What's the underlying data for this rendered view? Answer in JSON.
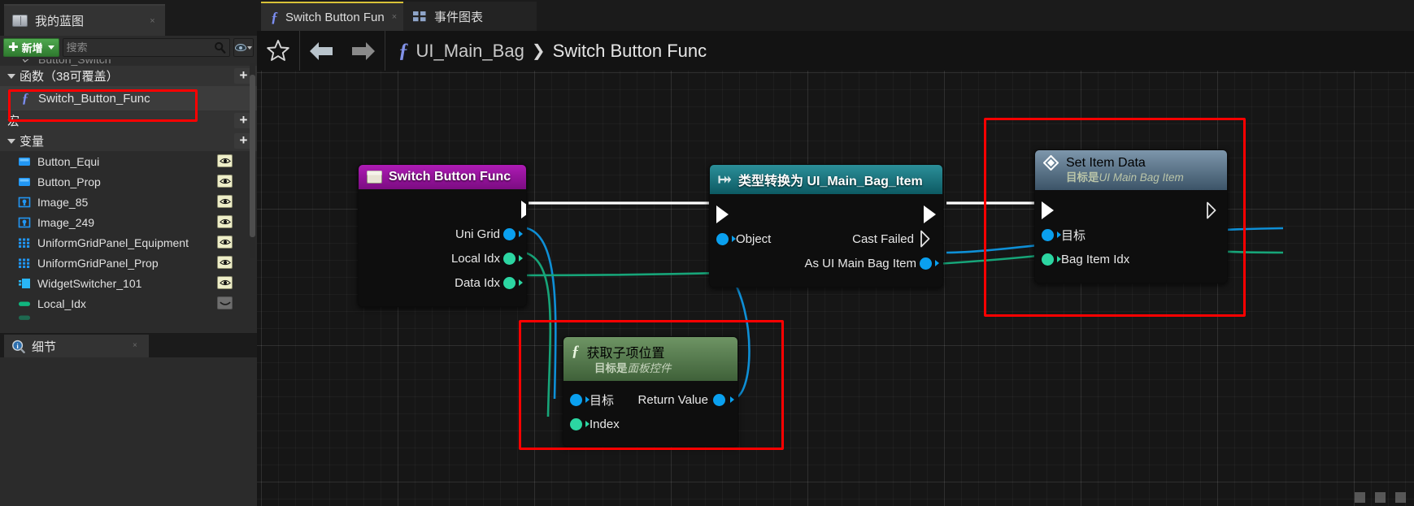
{
  "left_panel": {
    "tab": {
      "label": "我的蓝图",
      "icon": "blueprint-book-icon",
      "close": "×"
    },
    "toolbar": {
      "add_label": "新增",
      "add_icon": "plus-icon",
      "search_placeholder": "搜索",
      "search_value": "",
      "search_icon": "search-icon",
      "eye_icon": "eye-icon"
    },
    "clipped_row": {
      "label": "Button_Switch"
    },
    "sections": [
      {
        "label": "函数（38可覆盖）",
        "add": "+"
      },
      {
        "label": "宏",
        "add": "+"
      },
      {
        "label": "变量",
        "add": "+"
      }
    ],
    "function_item": {
      "label": "Switch_Button_Func",
      "icon": "function-icon"
    },
    "variables": [
      {
        "label": "Button_Equi",
        "icon": "button-widget-icon",
        "visible": true
      },
      {
        "label": "Button_Prop",
        "icon": "button-widget-icon",
        "visible": true
      },
      {
        "label": "Image_85",
        "icon": "image-widget-icon",
        "visible": true
      },
      {
        "label": "Image_249",
        "icon": "image-widget-icon",
        "visible": true
      },
      {
        "label": "UniformGridPanel_Equipment",
        "icon": "grid-panel-icon",
        "visible": true
      },
      {
        "label": "UniformGridPanel_Prop",
        "icon": "grid-panel-icon",
        "visible": true
      },
      {
        "label": "WidgetSwitcher_101",
        "icon": "widget-switcher-icon",
        "visible": true
      },
      {
        "label": "Local_Idx",
        "icon": "integer-variable-icon",
        "visible": false
      }
    ],
    "details": {
      "label": "细节",
      "icon": "details-info-icon",
      "close": "×"
    }
  },
  "graph": {
    "tabs": [
      {
        "label": "Switch Button Fun",
        "icon": "function-icon",
        "close": "×",
        "active": true
      },
      {
        "label": "事件图表",
        "icon": "event-graph-icon",
        "active": false
      }
    ],
    "toolbar": {
      "favorite_icon": "star-icon",
      "back_icon": "back-arrow-icon",
      "forward_icon": "forward-arrow-icon",
      "breadcrumb_icon": "function-icon",
      "breadcrumb": [
        "UI_Main_Bag",
        "Switch Button Func"
      ],
      "breadcrumb_separator": "❯"
    },
    "nodes": [
      {
        "id": "switch-button-func",
        "title": "Switch Button Func",
        "header_icon": "function-entry-icon",
        "header_color": "#a118a8",
        "outputs": [
          {
            "label": "",
            "type": "exec"
          },
          {
            "label": "Uni Grid",
            "type": "object"
          },
          {
            "label": "Local Idx",
            "type": "int"
          },
          {
            "label": "Data Idx",
            "type": "int"
          }
        ]
      },
      {
        "id": "cast-to-ui-main-bag-item",
        "title": "类型转换为 UI_Main_Bag_Item",
        "header_icon": "cast-icon",
        "header_color": "#1b7a85",
        "inputs": [
          {
            "label": "",
            "type": "exec"
          },
          {
            "label": "Object",
            "type": "object"
          }
        ],
        "outputs": [
          {
            "label": "",
            "type": "exec"
          },
          {
            "label": "Cast Failed",
            "type": "exec-hollow"
          },
          {
            "label": "As UI Main Bag Item",
            "type": "object"
          }
        ]
      },
      {
        "id": "set-item-data",
        "title": "Set Item Data",
        "subtitle_prefix": "目标是",
        "subtitle_target": "UI Main Bag Item",
        "header_icon": "function-call-diamond-icon",
        "header_color": "#53728c",
        "inputs": [
          {
            "label": "",
            "type": "exec"
          },
          {
            "label": "目标",
            "type": "object"
          },
          {
            "label": "Bag Item Idx",
            "type": "int"
          }
        ],
        "outputs": [
          {
            "label": "",
            "type": "exec-hollow"
          }
        ]
      },
      {
        "id": "get-child-at-index",
        "title": "获取子项位置",
        "subtitle_prefix": "目标是",
        "subtitle_target": "面板控件",
        "header_icon": "function-icon",
        "header_color": "#4e7a44",
        "inputs": [
          {
            "label": "目标",
            "type": "object"
          },
          {
            "label": "Index",
            "type": "int"
          }
        ],
        "outputs": [
          {
            "label": "Return Value",
            "type": "object"
          }
        ]
      }
    ],
    "annotations": [
      {
        "name": "highlight-set-item-data"
      },
      {
        "name": "highlight-get-child-at-index"
      },
      {
        "name": "highlight-function-item"
      }
    ]
  },
  "colors": {
    "exec_wire": "#ffffff",
    "object_wire": "#0aa0ef",
    "int_wire": "#2cd6a2",
    "highlight": "#ff0000",
    "accent_green": "#3f9b3f"
  }
}
